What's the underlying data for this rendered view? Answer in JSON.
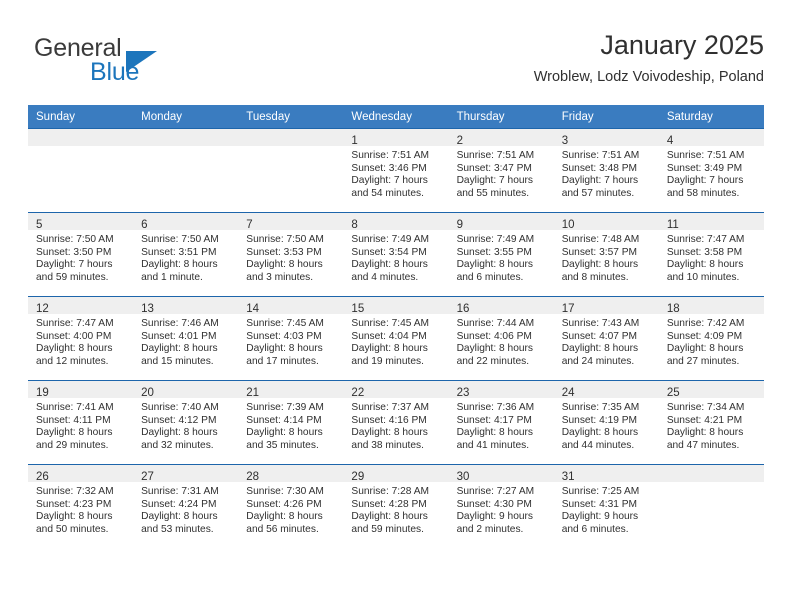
{
  "brand": {
    "name_top": "General",
    "name_bottom": "Blue",
    "accent_color": "#1c75bc"
  },
  "header": {
    "title": "January 2025",
    "subtitle": "Wroblew, Lodz Voivodeship, Poland"
  },
  "calendar": {
    "header_bg": "#3a7cc0",
    "row_border_color": "#1d65ab",
    "daynum_strip_bg": "#efefef",
    "weekday_headers": [
      "Sunday",
      "Monday",
      "Tuesday",
      "Wednesday",
      "Thursday",
      "Friday",
      "Saturday"
    ],
    "weeks": [
      [
        {
          "day": "",
          "lines": []
        },
        {
          "day": "",
          "lines": []
        },
        {
          "day": "",
          "lines": []
        },
        {
          "day": "1",
          "lines": [
            "Sunrise: 7:51 AM",
            "Sunset: 3:46 PM",
            "Daylight: 7 hours",
            "and 54 minutes."
          ]
        },
        {
          "day": "2",
          "lines": [
            "Sunrise: 7:51 AM",
            "Sunset: 3:47 PM",
            "Daylight: 7 hours",
            "and 55 minutes."
          ]
        },
        {
          "day": "3",
          "lines": [
            "Sunrise: 7:51 AM",
            "Sunset: 3:48 PM",
            "Daylight: 7 hours",
            "and 57 minutes."
          ]
        },
        {
          "day": "4",
          "lines": [
            "Sunrise: 7:51 AM",
            "Sunset: 3:49 PM",
            "Daylight: 7 hours",
            "and 58 minutes."
          ]
        }
      ],
      [
        {
          "day": "5",
          "lines": [
            "Sunrise: 7:50 AM",
            "Sunset: 3:50 PM",
            "Daylight: 7 hours",
            "and 59 minutes."
          ]
        },
        {
          "day": "6",
          "lines": [
            "Sunrise: 7:50 AM",
            "Sunset: 3:51 PM",
            "Daylight: 8 hours",
            "and 1 minute."
          ]
        },
        {
          "day": "7",
          "lines": [
            "Sunrise: 7:50 AM",
            "Sunset: 3:53 PM",
            "Daylight: 8 hours",
            "and 3 minutes."
          ]
        },
        {
          "day": "8",
          "lines": [
            "Sunrise: 7:49 AM",
            "Sunset: 3:54 PM",
            "Daylight: 8 hours",
            "and 4 minutes."
          ]
        },
        {
          "day": "9",
          "lines": [
            "Sunrise: 7:49 AM",
            "Sunset: 3:55 PM",
            "Daylight: 8 hours",
            "and 6 minutes."
          ]
        },
        {
          "day": "10",
          "lines": [
            "Sunrise: 7:48 AM",
            "Sunset: 3:57 PM",
            "Daylight: 8 hours",
            "and 8 minutes."
          ]
        },
        {
          "day": "11",
          "lines": [
            "Sunrise: 7:47 AM",
            "Sunset: 3:58 PM",
            "Daylight: 8 hours",
            "and 10 minutes."
          ]
        }
      ],
      [
        {
          "day": "12",
          "lines": [
            "Sunrise: 7:47 AM",
            "Sunset: 4:00 PM",
            "Daylight: 8 hours",
            "and 12 minutes."
          ]
        },
        {
          "day": "13",
          "lines": [
            "Sunrise: 7:46 AM",
            "Sunset: 4:01 PM",
            "Daylight: 8 hours",
            "and 15 minutes."
          ]
        },
        {
          "day": "14",
          "lines": [
            "Sunrise: 7:45 AM",
            "Sunset: 4:03 PM",
            "Daylight: 8 hours",
            "and 17 minutes."
          ]
        },
        {
          "day": "15",
          "lines": [
            "Sunrise: 7:45 AM",
            "Sunset: 4:04 PM",
            "Daylight: 8 hours",
            "and 19 minutes."
          ]
        },
        {
          "day": "16",
          "lines": [
            "Sunrise: 7:44 AM",
            "Sunset: 4:06 PM",
            "Daylight: 8 hours",
            "and 22 minutes."
          ]
        },
        {
          "day": "17",
          "lines": [
            "Sunrise: 7:43 AM",
            "Sunset: 4:07 PM",
            "Daylight: 8 hours",
            "and 24 minutes."
          ]
        },
        {
          "day": "18",
          "lines": [
            "Sunrise: 7:42 AM",
            "Sunset: 4:09 PM",
            "Daylight: 8 hours",
            "and 27 minutes."
          ]
        }
      ],
      [
        {
          "day": "19",
          "lines": [
            "Sunrise: 7:41 AM",
            "Sunset: 4:11 PM",
            "Daylight: 8 hours",
            "and 29 minutes."
          ]
        },
        {
          "day": "20",
          "lines": [
            "Sunrise: 7:40 AM",
            "Sunset: 4:12 PM",
            "Daylight: 8 hours",
            "and 32 minutes."
          ]
        },
        {
          "day": "21",
          "lines": [
            "Sunrise: 7:39 AM",
            "Sunset: 4:14 PM",
            "Daylight: 8 hours",
            "and 35 minutes."
          ]
        },
        {
          "day": "22",
          "lines": [
            "Sunrise: 7:37 AM",
            "Sunset: 4:16 PM",
            "Daylight: 8 hours",
            "and 38 minutes."
          ]
        },
        {
          "day": "23",
          "lines": [
            "Sunrise: 7:36 AM",
            "Sunset: 4:17 PM",
            "Daylight: 8 hours",
            "and 41 minutes."
          ]
        },
        {
          "day": "24",
          "lines": [
            "Sunrise: 7:35 AM",
            "Sunset: 4:19 PM",
            "Daylight: 8 hours",
            "and 44 minutes."
          ]
        },
        {
          "day": "25",
          "lines": [
            "Sunrise: 7:34 AM",
            "Sunset: 4:21 PM",
            "Daylight: 8 hours",
            "and 47 minutes."
          ]
        }
      ],
      [
        {
          "day": "26",
          "lines": [
            "Sunrise: 7:32 AM",
            "Sunset: 4:23 PM",
            "Daylight: 8 hours",
            "and 50 minutes."
          ]
        },
        {
          "day": "27",
          "lines": [
            "Sunrise: 7:31 AM",
            "Sunset: 4:24 PM",
            "Daylight: 8 hours",
            "and 53 minutes."
          ]
        },
        {
          "day": "28",
          "lines": [
            "Sunrise: 7:30 AM",
            "Sunset: 4:26 PM",
            "Daylight: 8 hours",
            "and 56 minutes."
          ]
        },
        {
          "day": "29",
          "lines": [
            "Sunrise: 7:28 AM",
            "Sunset: 4:28 PM",
            "Daylight: 8 hours",
            "and 59 minutes."
          ]
        },
        {
          "day": "30",
          "lines": [
            "Sunrise: 7:27 AM",
            "Sunset: 4:30 PM",
            "Daylight: 9 hours",
            "and 2 minutes."
          ]
        },
        {
          "day": "31",
          "lines": [
            "Sunrise: 7:25 AM",
            "Sunset: 4:31 PM",
            "Daylight: 9 hours",
            "and 6 minutes."
          ]
        },
        {
          "day": "",
          "lines": []
        }
      ]
    ]
  }
}
